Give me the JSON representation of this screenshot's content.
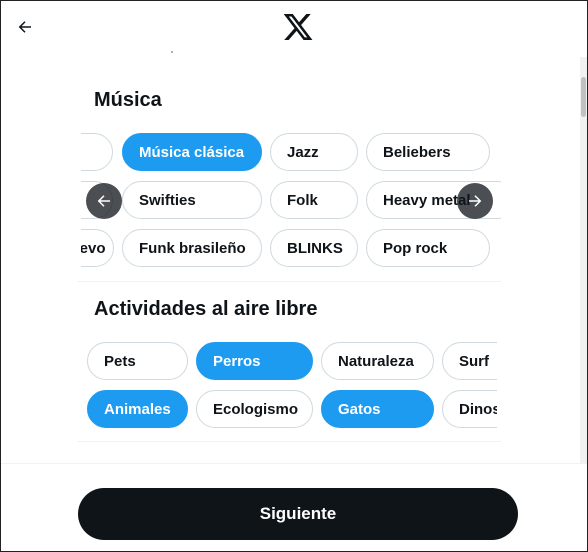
{
  "header": {
    "back_icon": "arrow-left-icon",
    "logo_icon": "x-logo-icon"
  },
  "sections": [
    {
      "title": "Música",
      "rows": [
        [
          "",
          "Música clásica",
          "Jazz",
          "Beliebers"
        ],
        [
          "",
          "Swifties",
          "Folk",
          "Heavy metal"
        ],
        [
          "Reguetón nuevo",
          "Funk brasileño",
          "BLINKS",
          "Pop rock"
        ]
      ],
      "selected": [
        "Música clásica"
      ]
    },
    {
      "title": "Actividades al aire libre",
      "rows": [
        [
          "Pets",
          "Perros",
          "Naturaleza",
          "Surf"
        ],
        [
          "Animales",
          "Ecologismo",
          "Gatos",
          "Dinosaurios"
        ]
      ],
      "selected": [
        "Perros",
        "Animales",
        "Gatos"
      ]
    }
  ],
  "footer": {
    "next_label": "Siguiente"
  },
  "colors": {
    "accent": "#1d9bf0",
    "dark": "#0f1419",
    "border": "#cfd9de"
  }
}
